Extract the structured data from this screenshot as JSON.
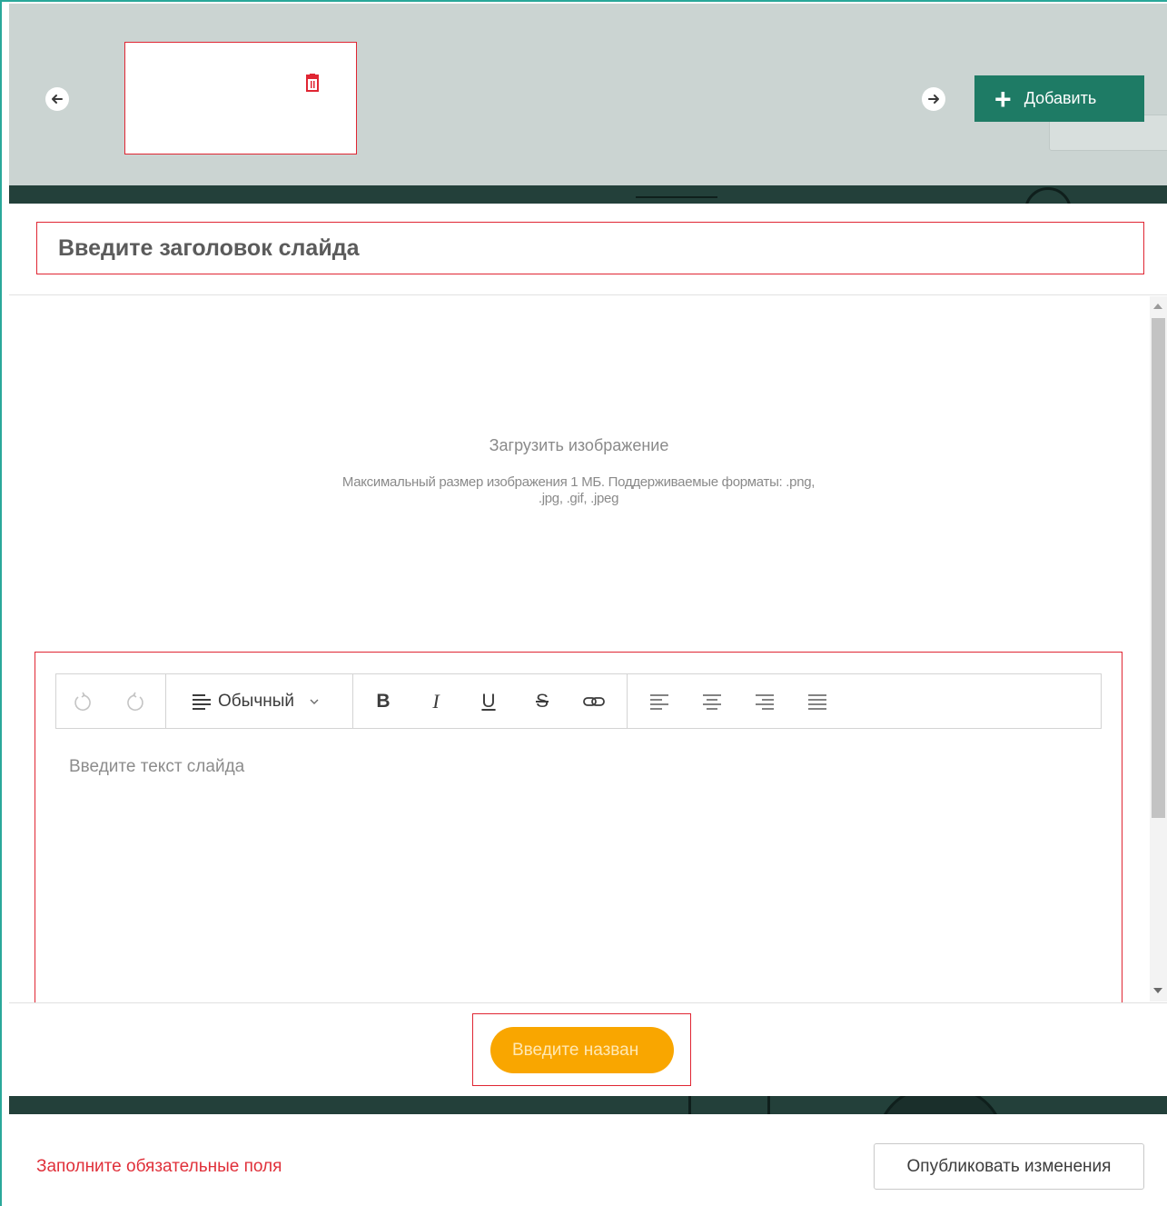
{
  "slider": {
    "add_label": "Добавить"
  },
  "slide": {
    "title_placeholder": "Введите заголовок слайда",
    "upload_label": "Загрузить изображение",
    "upload_hint": "Максимальный размер изображения 1 МБ. Поддерживаемые форматы: .png, .jpg, .gif, .jpeg",
    "text_placeholder": "Введите текст слайда",
    "button_placeholder": "Введите назван"
  },
  "editor": {
    "format_value": "Обычный"
  },
  "footer": {
    "warning": "Заполните обязательные поля",
    "publish_label": "Опубликовать изменения"
  },
  "colors": {
    "accent_green": "#1e7b65",
    "error_red": "#e02633",
    "cta_orange": "#f9a600"
  }
}
